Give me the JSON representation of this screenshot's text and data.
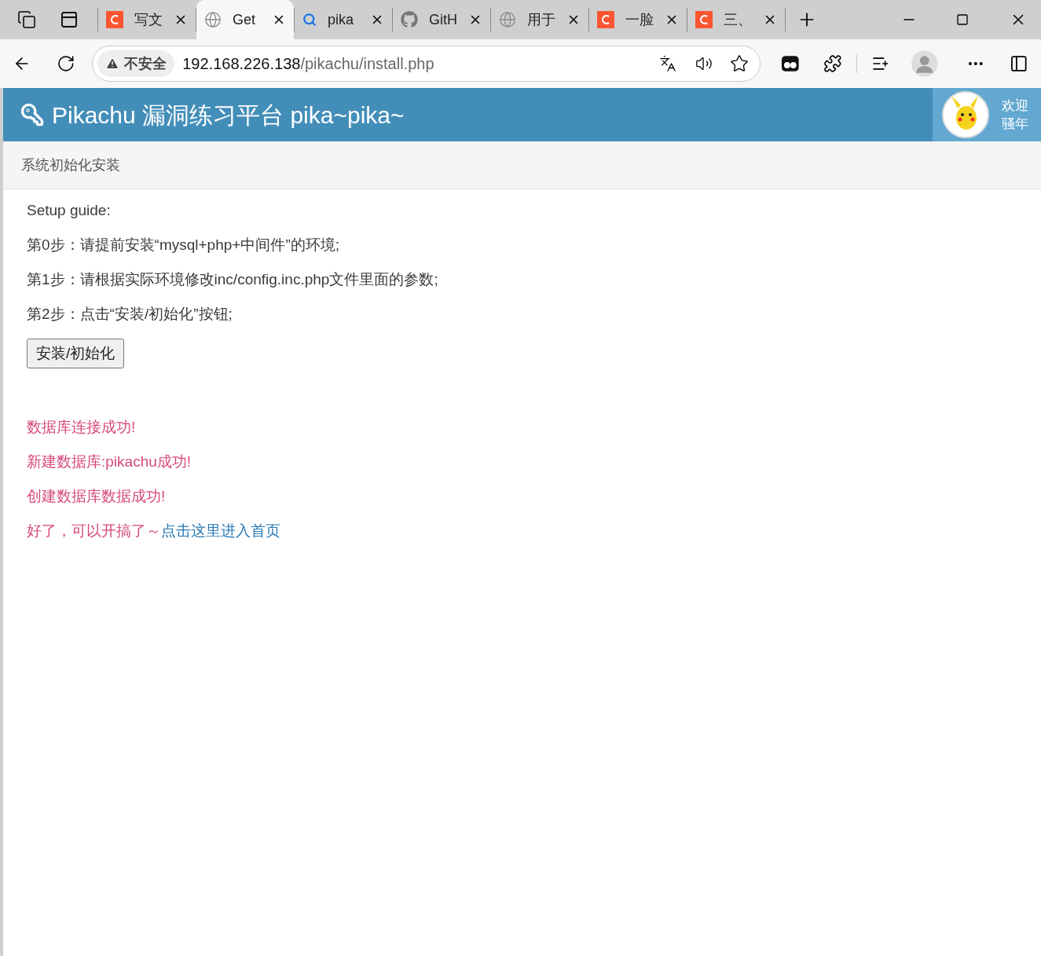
{
  "tabs": [
    {
      "kind": "c-logo",
      "title": "写文",
      "selected": false
    },
    {
      "kind": "globe",
      "title": "Get",
      "selected": true
    },
    {
      "kind": "search",
      "title": "pika",
      "selected": false
    },
    {
      "kind": "github",
      "title": "GitH",
      "selected": false
    },
    {
      "kind": "globe",
      "title": "用于",
      "selected": false
    },
    {
      "kind": "c-logo",
      "title": "一脸",
      "selected": false
    },
    {
      "kind": "c-logo",
      "title": "三、",
      "selected": false
    }
  ],
  "address_bar": {
    "security": "不安全",
    "host": "192.168.226.138",
    "path": "/pikachu/install.php"
  },
  "header": {
    "title": "Pikachu 漏洞练习平台 pika~pika~",
    "welcome": "欢迎",
    "user": "骚年"
  },
  "breadcrumb": "系统初始化安装",
  "guide": [
    "Setup guide:",
    "第0步：请提前安装“mysql+php+中间件”的环境;",
    "第1步：请根据实际环境修改inc/config.inc.php文件里面的参数;",
    "第2步：点击“安装/初始化”按钮;"
  ],
  "install_button": "安装/初始化",
  "messages": [
    {
      "text": "数据库连接成功!"
    },
    {
      "text": "新建数据库:pikachu成功!"
    },
    {
      "text": "创建数据库数据成功!"
    },
    {
      "text": "好了，可以开搞了～",
      "link": "点击这里进入首页"
    }
  ]
}
